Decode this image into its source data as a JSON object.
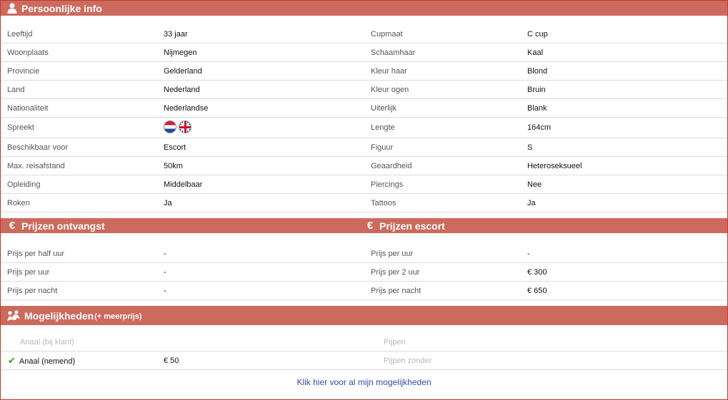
{
  "personal": {
    "title": "Persoonlijke info",
    "rows": [
      {
        "l1": "Leeftijd",
        "v1": "33 jaar",
        "l2": "Cupmaat",
        "v2": "C cup"
      },
      {
        "l1": "Woonplaats",
        "v1": "Nijmegen",
        "l2": "Schaamhaar",
        "v2": "Kaal"
      },
      {
        "l1": "Provincie",
        "v1": "Gelderland",
        "l2": "Kleur haar",
        "v2": "Blond"
      },
      {
        "l1": "Land",
        "v1": "Nederland",
        "l2": "Kleur ogen",
        "v2": "Bruin"
      },
      {
        "l1": "Nationaliteit",
        "v1": "Nederlandse",
        "l2": "Uiterlijk",
        "v2": "Blank"
      },
      {
        "l1": "Spreekt",
        "v1": "",
        "l2": "Lengte",
        "v2": "164cm"
      },
      {
        "l1": "Beschikbaar voor",
        "v1": "Escort",
        "l2": "Figuur",
        "v2": "S"
      },
      {
        "l1": "Max. reisafstand",
        "v1": "50km",
        "l2": "Geaardheid",
        "v2": "Heteroseksueel"
      },
      {
        "l1": "Opleiding",
        "v1": "Middelbaar",
        "l2": "Piercings",
        "v2": "Nee"
      },
      {
        "l1": "Roken",
        "v1": "Ja",
        "l2": "Tattoos",
        "v2": "Ja"
      }
    ],
    "languages": [
      "nl-flag-icon",
      "uk-flag-icon"
    ]
  },
  "prices_incall": {
    "title": "Prijzen ontvangst",
    "icon": "euro-icon",
    "rows": [
      {
        "label": "Prijs per half uur",
        "value": "-"
      },
      {
        "label": "Prijs per uur",
        "value": "-"
      },
      {
        "label": "Prijs per nacht",
        "value": "-"
      }
    ]
  },
  "prices_escort": {
    "title": "Prijzen escort",
    "icon": "euro-icon",
    "rows": [
      {
        "label": "Prijs per uur",
        "value": "-"
      },
      {
        "label": "Prijs per 2 uur",
        "value": "€ 300"
      },
      {
        "label": "Prijs per nacht",
        "value": "€ 650"
      }
    ]
  },
  "options": {
    "title": "Mogelijkheden",
    "subtitle": "(+ meerprijs)",
    "rows": [
      {
        "l1": "Anaal (bij klant)",
        "v1": "",
        "l2": "Pijpen",
        "checked1": false
      },
      {
        "l1": "Anaal (nemend)",
        "v1": "€ 50",
        "l2": "Pijpen zonder",
        "checked1": true
      }
    ],
    "link": "Klik hier voor al mijn mogelijkheden"
  },
  "colors": {
    "header_bg": "#cc6a5e",
    "link": "#3a48a8",
    "check": "#3a9d23"
  }
}
